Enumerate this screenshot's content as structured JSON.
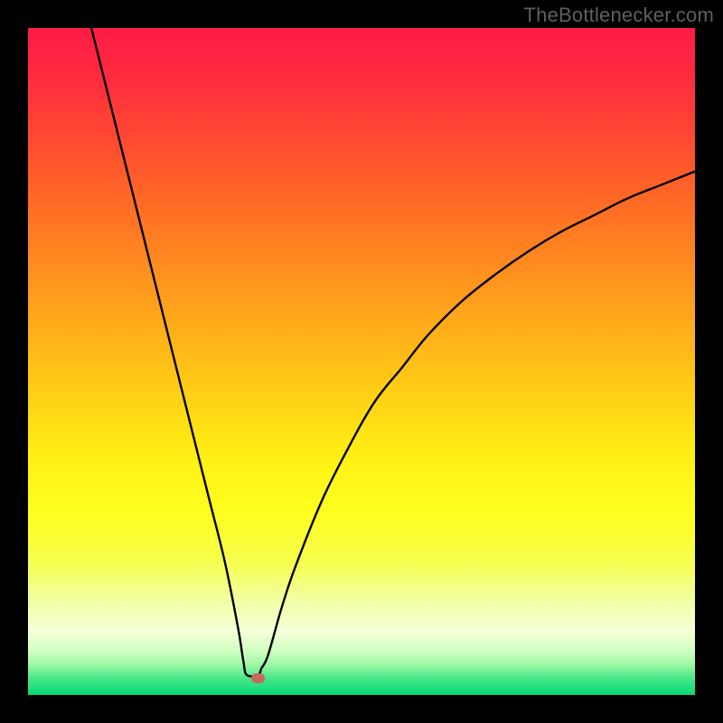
{
  "watermark": "TheBottlenecker.com",
  "chart_data": {
    "type": "line",
    "title": "",
    "xlabel": "",
    "ylabel": "",
    "x_range": [
      0,
      100
    ],
    "y_range": [
      0,
      100
    ],
    "notch_x": 33,
    "marker": {
      "x": 34.5,
      "y": 2.5
    },
    "series": [
      {
        "name": "curve",
        "points": [
          {
            "x": 9.5,
            "y": 100
          },
          {
            "x": 12,
            "y": 90
          },
          {
            "x": 14.5,
            "y": 80
          },
          {
            "x": 17,
            "y": 70
          },
          {
            "x": 19.5,
            "y": 60
          },
          {
            "x": 22,
            "y": 50
          },
          {
            "x": 24.5,
            "y": 40
          },
          {
            "x": 27,
            "y": 30
          },
          {
            "x": 29.5,
            "y": 20
          },
          {
            "x": 31.5,
            "y": 10
          },
          {
            "x": 32.3,
            "y": 5
          },
          {
            "x": 32.8,
            "y": 3
          },
          {
            "x": 34.5,
            "y": 3
          },
          {
            "x": 35,
            "y": 4
          },
          {
            "x": 36,
            "y": 6
          },
          {
            "x": 38,
            "y": 13
          },
          {
            "x": 40,
            "y": 19
          },
          {
            "x": 44,
            "y": 29
          },
          {
            "x": 48,
            "y": 37
          },
          {
            "x": 52,
            "y": 44
          },
          {
            "x": 56,
            "y": 49
          },
          {
            "x": 60,
            "y": 54
          },
          {
            "x": 65,
            "y": 59
          },
          {
            "x": 70,
            "y": 63
          },
          {
            "x": 75,
            "y": 66.5
          },
          {
            "x": 80,
            "y": 69.5
          },
          {
            "x": 85,
            "y": 72
          },
          {
            "x": 90,
            "y": 74.5
          },
          {
            "x": 95,
            "y": 76.5
          },
          {
            "x": 100,
            "y": 78.5
          }
        ]
      }
    ],
    "gradient_stops": [
      {
        "pos": 0.0,
        "color": "#ff1b45"
      },
      {
        "pos": 0.07,
        "color": "#ff2a3f"
      },
      {
        "pos": 0.15,
        "color": "#ff4433"
      },
      {
        "pos": 0.25,
        "color": "#ff6626"
      },
      {
        "pos": 0.35,
        "color": "#ff8a1f"
      },
      {
        "pos": 0.45,
        "color": "#ffad1a"
      },
      {
        "pos": 0.55,
        "color": "#ffd015"
      },
      {
        "pos": 0.65,
        "color": "#fff214"
      },
      {
        "pos": 0.73,
        "color": "#feff20"
      },
      {
        "pos": 0.8,
        "color": "#f6ff4d"
      },
      {
        "pos": 0.86,
        "color": "#f1ffa6"
      },
      {
        "pos": 0.905,
        "color": "#f5ffd8"
      },
      {
        "pos": 0.935,
        "color": "#cfffc1"
      },
      {
        "pos": 0.955,
        "color": "#9bf7a2"
      },
      {
        "pos": 0.975,
        "color": "#48e88a"
      },
      {
        "pos": 1.0,
        "color": "#05d873"
      }
    ]
  }
}
